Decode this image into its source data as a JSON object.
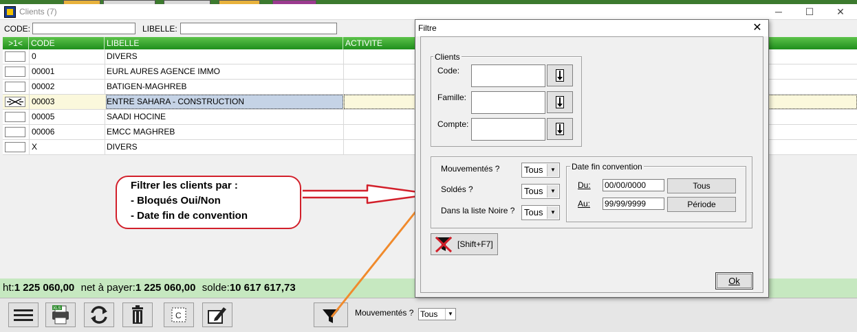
{
  "app": {
    "title": "Clients (7)"
  },
  "filters": {
    "code_label": "CODE:",
    "libelle_label": "LIBELLE:",
    "code_value": "",
    "libelle_value": ""
  },
  "grid": {
    "headers": [
      ">1<",
      "CODE",
      "LIBELLE",
      "ACTIVITE"
    ],
    "rows": [
      {
        "code": "0",
        "libelle": "DIVERS"
      },
      {
        "code": "00001",
        "libelle": "EURL AURES AGENCE IMMO"
      },
      {
        "code": "00002",
        "libelle": "BATIGEN-MAGHREB"
      },
      {
        "code": "00003",
        "libelle": "ENTRE SAHARA - CONSTRUCTION"
      },
      {
        "code": "00005",
        "libelle": "SAADI HOCINE"
      },
      {
        "code": "00006",
        "libelle": "EMCC MAGHREB"
      },
      {
        "code": "X",
        "libelle": "DIVERS"
      }
    ],
    "selected_row_index": 3
  },
  "callout": {
    "line1": "Filtrer les clients par :",
    "line2": "- Bloqués Oui/Non",
    "line3": "- Date fin de convention"
  },
  "totals": {
    "ht_label": "ht:",
    "ht_value": "1 225 060,00",
    "net_label": "net à payer:",
    "net_value": "1 225 060,00",
    "solde_label": "solde:",
    "solde_value": "10 617 617,73"
  },
  "toolbar": {
    "mouvementes_label": "Mouvementés ?",
    "mouvementes_value": "Tous",
    "icons": [
      "menu-icon",
      "print-xls-icon",
      "refresh-icon",
      "trash-icon",
      "copy-icon",
      "edit-icon",
      "filter-icon"
    ]
  },
  "dialog": {
    "title": "Filtre",
    "close": "✕",
    "clients_group": "Clients",
    "code_label": "Code:",
    "famille_label": "Famille:",
    "compte_label": "Compte:",
    "mouvementes_label": "Mouvementés ?",
    "mouvementes_value": "Tous",
    "soldes_label": "Soldés ?",
    "soldes_value": "Tous",
    "liste_noire_label": "Dans la liste Noire ?",
    "liste_noire_value": "Tous",
    "date_group": "Date fin convention",
    "du_label": "Du:",
    "du_value": "00/00/0000",
    "au_label": "Au:",
    "au_value": "99/99/9999",
    "tous_button": "Tous",
    "periode_button": "Période",
    "reset_shortcut": "[Shift+F7]",
    "ok_button": "Ok"
  },
  "colors": {
    "header_green": "#1f8f1c",
    "totals_green": "#c6e8c0",
    "callout_red": "#d21f2a",
    "arrow_orange": "#f08a2c"
  }
}
